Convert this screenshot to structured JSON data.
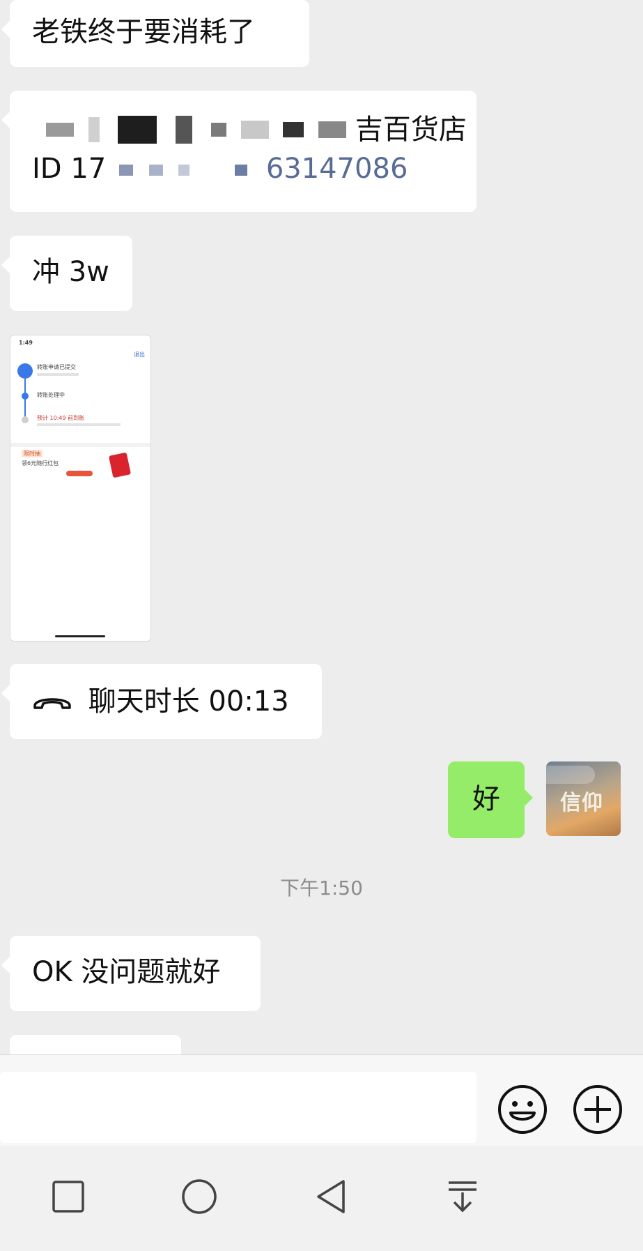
{
  "messages": {
    "m1": "老铁终于要消耗了",
    "m2_line1_visible": "吉百货店",
    "m2_id_prefix": "ID 17",
    "m2_id_suffix": "63147086",
    "m3": "冲 3w",
    "m4_call": "聊天时长 00:13",
    "m5_self": "好",
    "m6": "OK 没问题就好"
  },
  "timestamp": "下午1:50",
  "thumbnail": {
    "time": "1:49",
    "top_right": "退出",
    "step1_title": "转账申请已提交",
    "step2_title": "转账处理中",
    "step3_title": "预计 10:49 前到账",
    "promo_tag": "限时抽",
    "promo_title": "领6元随行红包"
  },
  "avatar_text": "信仰",
  "icons": {
    "call": "phone-hangup-icon",
    "emoji": "emoji-icon",
    "plus": "plus-icon",
    "nav_recent": "square-icon",
    "nav_home": "circle-icon",
    "nav_back": "triangle-back-icon",
    "nav_menu": "pulldown-icon"
  },
  "colors": {
    "bg": "#ededed",
    "bubble": "#ffffff",
    "self_bubble": "#95ec69",
    "link": "#576b95"
  }
}
